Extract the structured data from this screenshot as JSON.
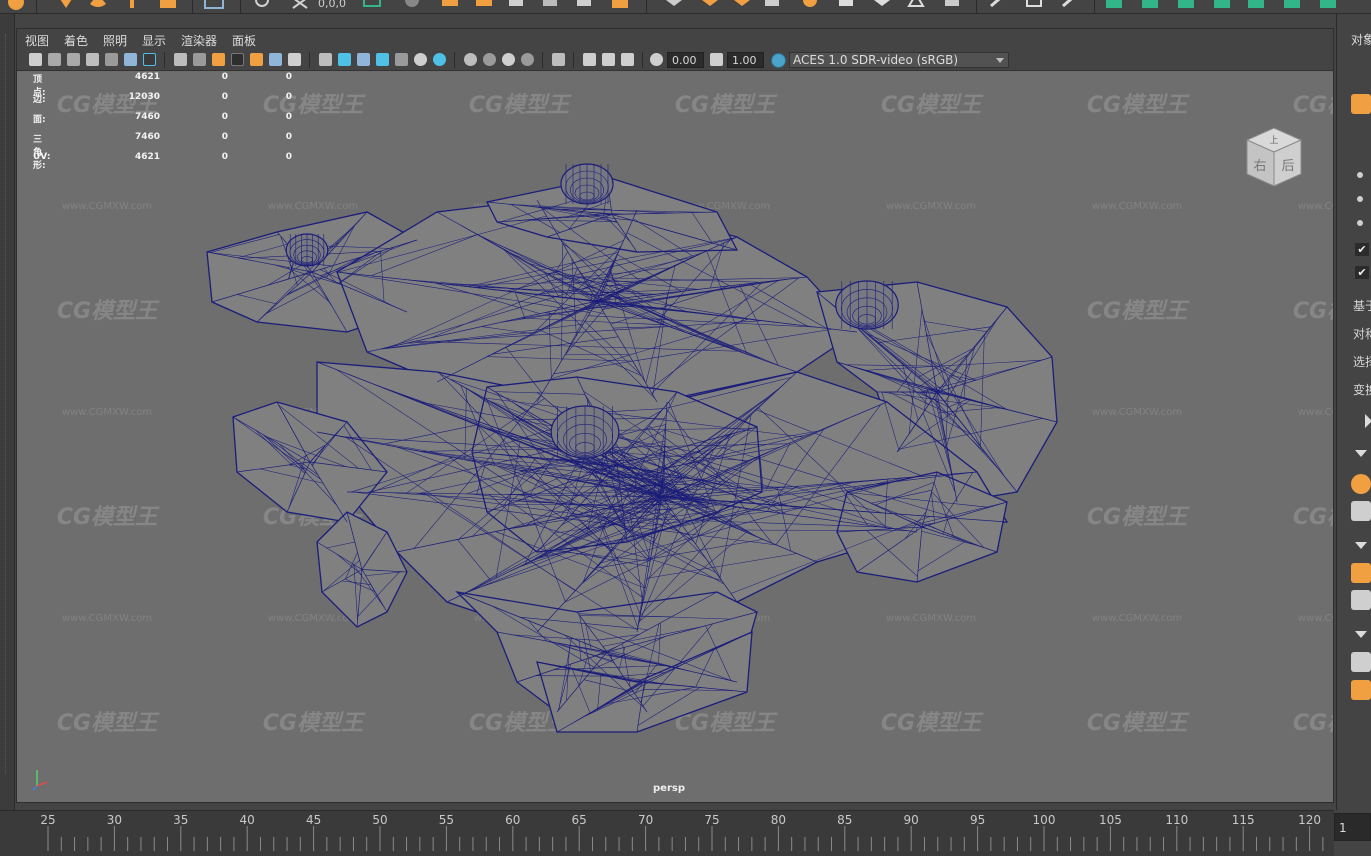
{
  "shelf": {
    "coord_readout": "0,0,0",
    "icons": [
      "sphere-icon",
      "move-icon",
      "shape-icon",
      "text-icon",
      "curve-icon",
      "grid-icon",
      "lasso-icon",
      "snap-icon",
      "box-icon",
      "cube-icon",
      "cube-icon",
      "grid-icon",
      "cube-icon",
      "cube-icon",
      "cube-icon",
      "cube-icon",
      "cube-icon",
      "cube-icon",
      "brush-icon",
      "cube-icon",
      "render-icon"
    ]
  },
  "menu": {
    "items": [
      "视图",
      "着色",
      "照明",
      "显示",
      "渲染器",
      "面板"
    ]
  },
  "toolbar": {
    "exposure": "0.00",
    "gamma": "1.00",
    "color_space": "ACES 1.0 SDR-video (sRGB)"
  },
  "hud": {
    "rows": [
      {
        "label": "顶点:",
        "v1": "4621",
        "v2": "0",
        "v3": "0"
      },
      {
        "label": "边:",
        "v1": "12030",
        "v2": "0",
        "v3": "0"
      },
      {
        "label": "面:",
        "v1": "7460",
        "v2": "0",
        "v3": "0"
      },
      {
        "label": "三角形:",
        "v1": "7460",
        "v2": "0",
        "v3": "0"
      },
      {
        "label": "UV:",
        "v1": "4621",
        "v2": "0",
        "v3": "0"
      }
    ]
  },
  "viewport": {
    "camera_label": "persp",
    "viewcube": {
      "top_face": "上",
      "left_face": "右",
      "right_face": "后"
    },
    "watermark": {
      "brand": "CG模型王",
      "url": "www.CGMXW.com"
    }
  },
  "right_panel": {
    "title": "对象",
    "labels": [
      "基于",
      "对称",
      "选择",
      "变换"
    ]
  },
  "timeline": {
    "ticks": [
      "25",
      "30",
      "35",
      "40",
      "45",
      "50",
      "55",
      "60",
      "65",
      "70",
      "75",
      "80",
      "85",
      "90",
      "95",
      "100",
      "105",
      "110",
      "115",
      "120"
    ],
    "current_frame": "1"
  },
  "colors": {
    "wire": "#1b1d7a",
    "mesh_fill": "#808080",
    "accent_orange": "#f0a040",
    "accent_teal": "#33b58a"
  }
}
